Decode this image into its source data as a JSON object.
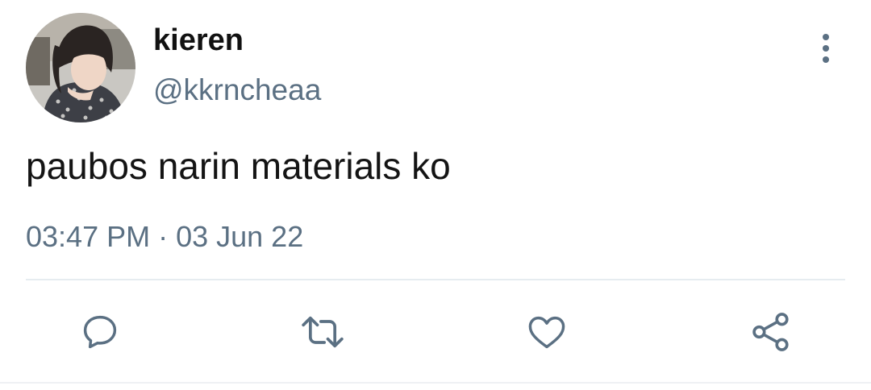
{
  "tweet": {
    "display_name": "kieren",
    "handle": "@kkrncheaa",
    "text": "paubos narin materials ko",
    "time": "03:47 PM",
    "separator": "·",
    "date": "03 Jun 22"
  },
  "icons": {
    "more": "more-vertical-icon",
    "reply": "reply-icon",
    "retweet": "retweet-icon",
    "like": "heart-icon",
    "share": "share-icon"
  },
  "colors": {
    "secondary_text": "#5b7083",
    "icon": "#5b7083",
    "divider": "#e6ecf0"
  }
}
